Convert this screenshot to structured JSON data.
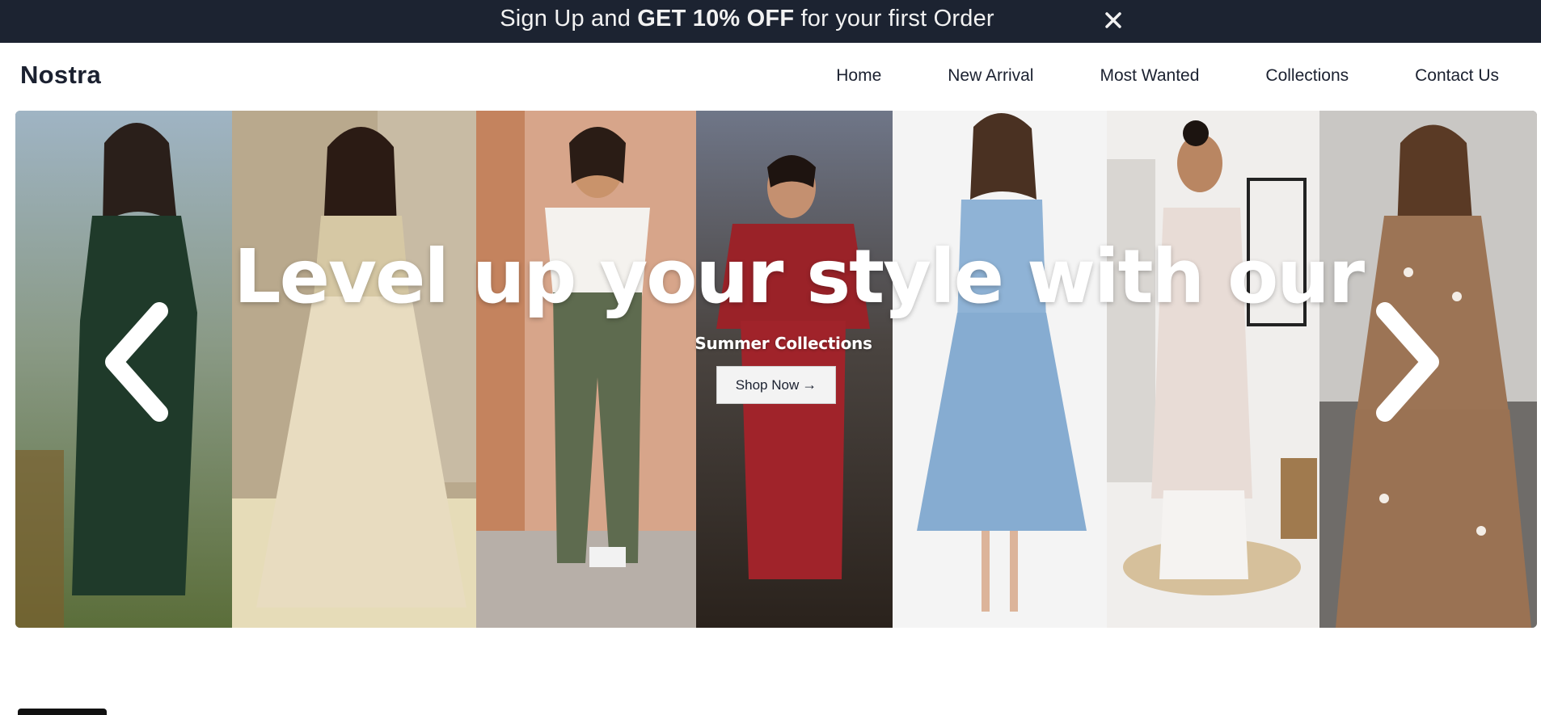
{
  "promo": {
    "text_before": "Sign Up and ",
    "text_bold": "GET 10% OFF",
    "text_after": " for your first Order",
    "close_icon": "close-icon"
  },
  "nav": {
    "logo": "Nostra",
    "links": [
      "Home",
      "New Arrival",
      "Most Wanted",
      "Collections",
      "Contact Us"
    ]
  },
  "hero": {
    "title": "Level up your style with our",
    "subtitle": "Summer Collections",
    "cta_label": "Shop Now",
    "cta_icon": "arrow-right-icon",
    "prev_icon": "chevron-left-icon",
    "next_icon": "chevron-right-icon",
    "panels": [
      {
        "name": "green-wrap-dress",
        "bg": "#7f95a0",
        "garment": "#1f3a2a"
      },
      {
        "name": "cream-lehenga",
        "bg": "#b8a488",
        "garment": "#e8dcc0"
      },
      {
        "name": "tee-and-green-trousers",
        "bg": "#d7a58a",
        "garment": "#5e6b4f"
      },
      {
        "name": "red-knit-set",
        "bg": "#46403c",
        "garment": "#a0232a"
      },
      {
        "name": "denim-shirt-dress",
        "bg": "#f4f4f4",
        "garment": "#8fb3d6"
      },
      {
        "name": "white-kurta-set",
        "bg": "#f0eeec",
        "garment": "#e8dcd6"
      },
      {
        "name": "brown-embroidered-dress",
        "bg": "#c9c7c4",
        "garment": "#9c7455"
      }
    ]
  },
  "colors": {
    "promo_bg": "#1c2331",
    "text_dark": "#1b2130"
  }
}
